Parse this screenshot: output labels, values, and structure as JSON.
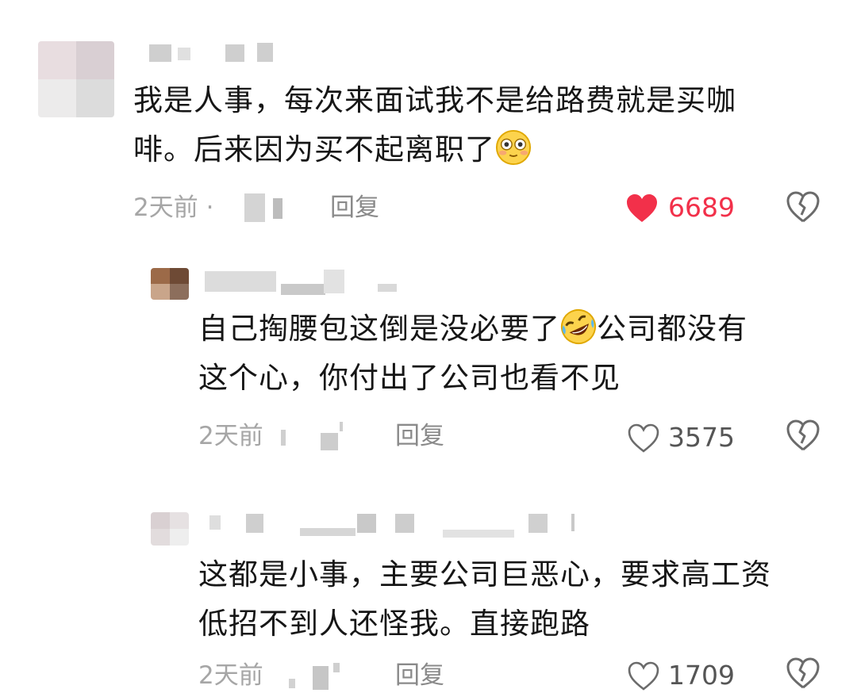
{
  "comments": [
    {
      "text_line1": "我是人事，每次来面试我不是给路费就是买咖",
      "text_line2": "啡。后来因为买不起离职了",
      "emoji": "flushed-face-emoji",
      "time": "2天前 ·",
      "reply": "回复",
      "likes": "6689",
      "liked": true
    },
    {
      "text_line1_a": "自己掏腰包这倒是没必要了",
      "emoji": "rolling-on-floor-laughing-emoji",
      "text_line1_b": "公司都没有",
      "text_line2": "这个心，你付出了公司也看不见",
      "time": "2天前",
      "reply": "回复",
      "likes": "3575",
      "liked": false
    },
    {
      "text_line1": "这都是小事，主要公司巨恶心，要求高工资",
      "text_line2": "低招不到人还怪我。直接跑路",
      "time": "2天前",
      "reply": "回复",
      "likes": "1709",
      "liked": false
    }
  ],
  "colors": {
    "like_active": "#f2304a",
    "icon_gray": "#6b6b6b",
    "meta_gray": "#a6a6a6"
  }
}
